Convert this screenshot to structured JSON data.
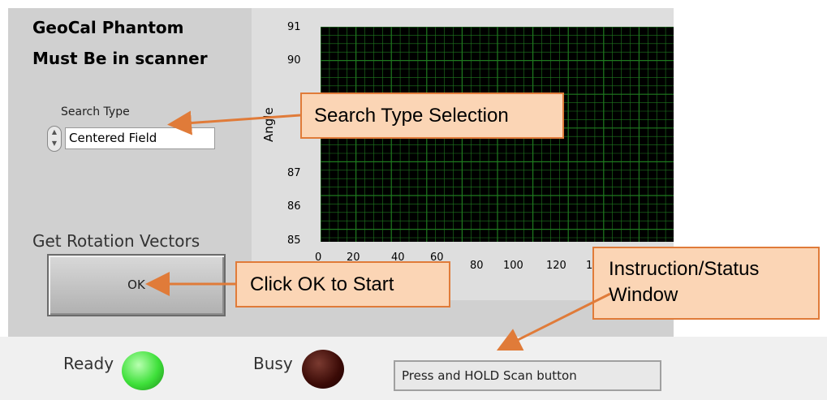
{
  "header": {
    "line1": "GeoCal Phantom",
    "line2": "Must Be in scanner"
  },
  "search_type": {
    "label": "Search Type",
    "value": "Centered Field"
  },
  "rotation": {
    "label": "Get Rotation Vectors",
    "ok_label": "OK"
  },
  "chart": {
    "y_label": "Angle",
    "y_ticks": [
      "91",
      "90",
      "87",
      "86",
      "85"
    ],
    "x_ticks": [
      "0",
      "20",
      "40",
      "60",
      "80",
      "100",
      "120",
      "1"
    ]
  },
  "indicators": {
    "ready_label": "Ready",
    "busy_label": "Busy",
    "ready_color": "#3ee03a",
    "busy_color": "#3a0a06"
  },
  "status": {
    "text": "Press and HOLD Scan button"
  },
  "callouts": {
    "search_type": "Search Type Selection",
    "ok": "Click OK to Start",
    "status_line1": "Instruction/Status",
    "status_line2": "Window"
  },
  "colors": {
    "callout_fill": "#fbd5b5",
    "callout_border": "#e07b39",
    "grid_line": "#1f7a1f"
  }
}
